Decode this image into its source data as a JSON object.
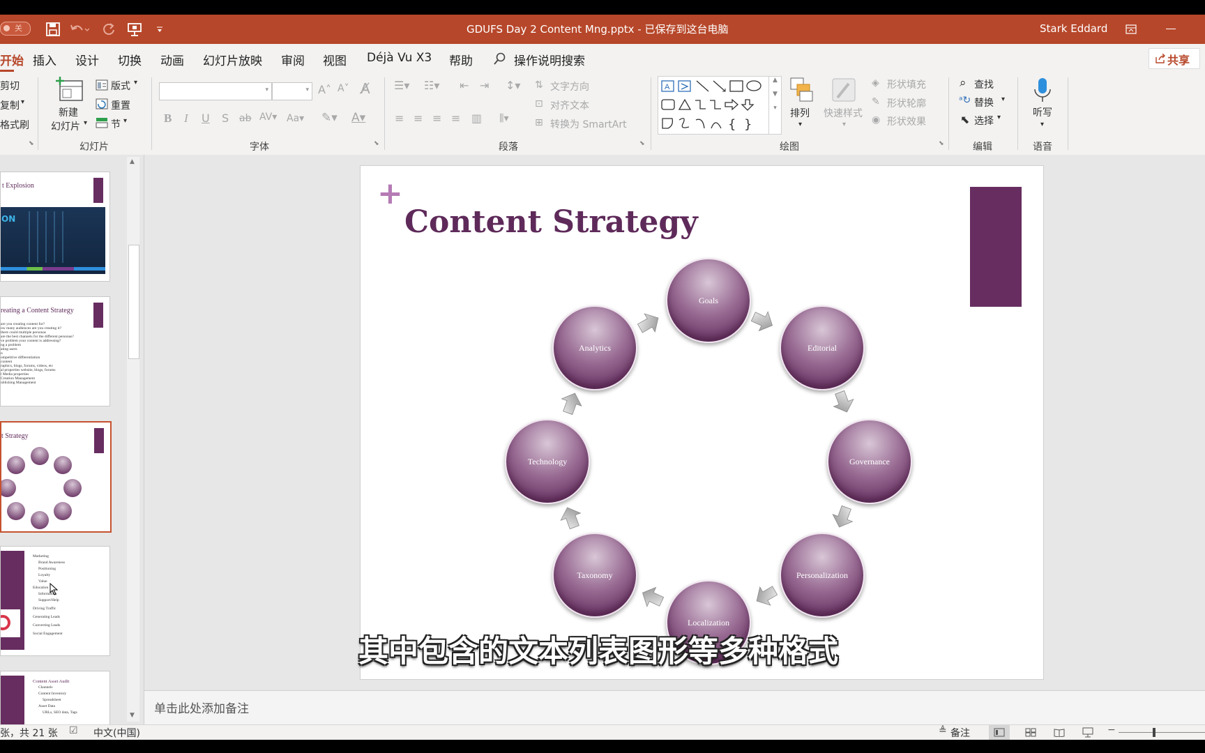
{
  "titlebar": {
    "autosave": "关",
    "doc_title": "GDUFS Day 2 Content Mng.pptx",
    "separator": "-",
    "save_status": "已保存到这台电脑",
    "user": "Stark Eddard"
  },
  "menu": {
    "items": [
      "开始",
      "插入",
      "设计",
      "切换",
      "动画",
      "幻灯片放映",
      "审阅",
      "视图",
      "Déjà Vu X3",
      "帮助"
    ],
    "search": "操作说明搜索",
    "share": "共享"
  },
  "ribbon": {
    "clipboard": {
      "cut": "剪切",
      "copy": "复制",
      "format_painter": "格式刷"
    },
    "slides": {
      "new_slide_1": "新建",
      "new_slide_2": "幻灯片",
      "layout": "版式",
      "reset": "重置",
      "section": "节",
      "group": "幻灯片"
    },
    "font": {
      "group": "字体"
    },
    "paragraph": {
      "text_direction": "文字方向",
      "align_text": "对齐文本",
      "smartart": "转换为 SmartArt",
      "group": "段落"
    },
    "drawing": {
      "arrange": "排列",
      "quick_styles": "快速样式",
      "shape_fill": "形状填充",
      "shape_outline": "形状轮廓",
      "shape_effects": "形状效果",
      "group": "绘图"
    },
    "editing": {
      "find": "查找",
      "replace": "替换",
      "select": "选择",
      "group": "编辑"
    },
    "voice": {
      "dictate": "听写",
      "group": "语音"
    }
  },
  "thumbnails": [
    {
      "title": "t Explosion",
      "overlay": "ON"
    },
    {
      "title": "reating a Content Strategy",
      "lines": [
        "are you creating content for?",
        "ow many audiences are you creating it?",
        "there could multiple personas",
        "are the best channels for the different personas?",
        "ve problem your content is addressing?",
        "ng a problem",
        "ating users",
        "n",
        "ompetitive differentiation",
        "content",
        "raphics, blogs, forums, videos, etc",
        "al properties website, blogs, forums",
        "l Media properties",
        "Creation Management",
        "ublishing Management"
      ]
    },
    {
      "title": "t Strategy"
    },
    {
      "lines": [
        "Marketing",
        "Brand Awareness",
        "Positioning",
        "Loyalty",
        "Value",
        "Education",
        "Information",
        "Support/Help",
        "Driving Traffic",
        "Generating Leads",
        "Converting Leads",
        "Social Engagement"
      ]
    },
    {
      "lines": [
        "Content Asset Audit",
        "Channels",
        "Content Inventory",
        "Spreadsheet",
        "Asset Data",
        "URLs, SEO data, Tags"
      ]
    }
  ],
  "slide": {
    "plus": "+",
    "title": "Content Strategy",
    "cycle": [
      "Goals",
      "Editorial",
      "Governance",
      "Personalization",
      "Localization",
      "Taxonomy",
      "Technology",
      "Analytics"
    ]
  },
  "subtitle": "其中包含的文本列表图形等多种格式",
  "notes_placeholder": "单击此处添加备注",
  "status": {
    "slide_count": "张，共 21 张",
    "language": "中文(中国)",
    "notes_button": "备注"
  },
  "colors": {
    "brand": "#b7472a",
    "slide_purple": "#5e2a5a",
    "accent_bar": "#672d60"
  }
}
